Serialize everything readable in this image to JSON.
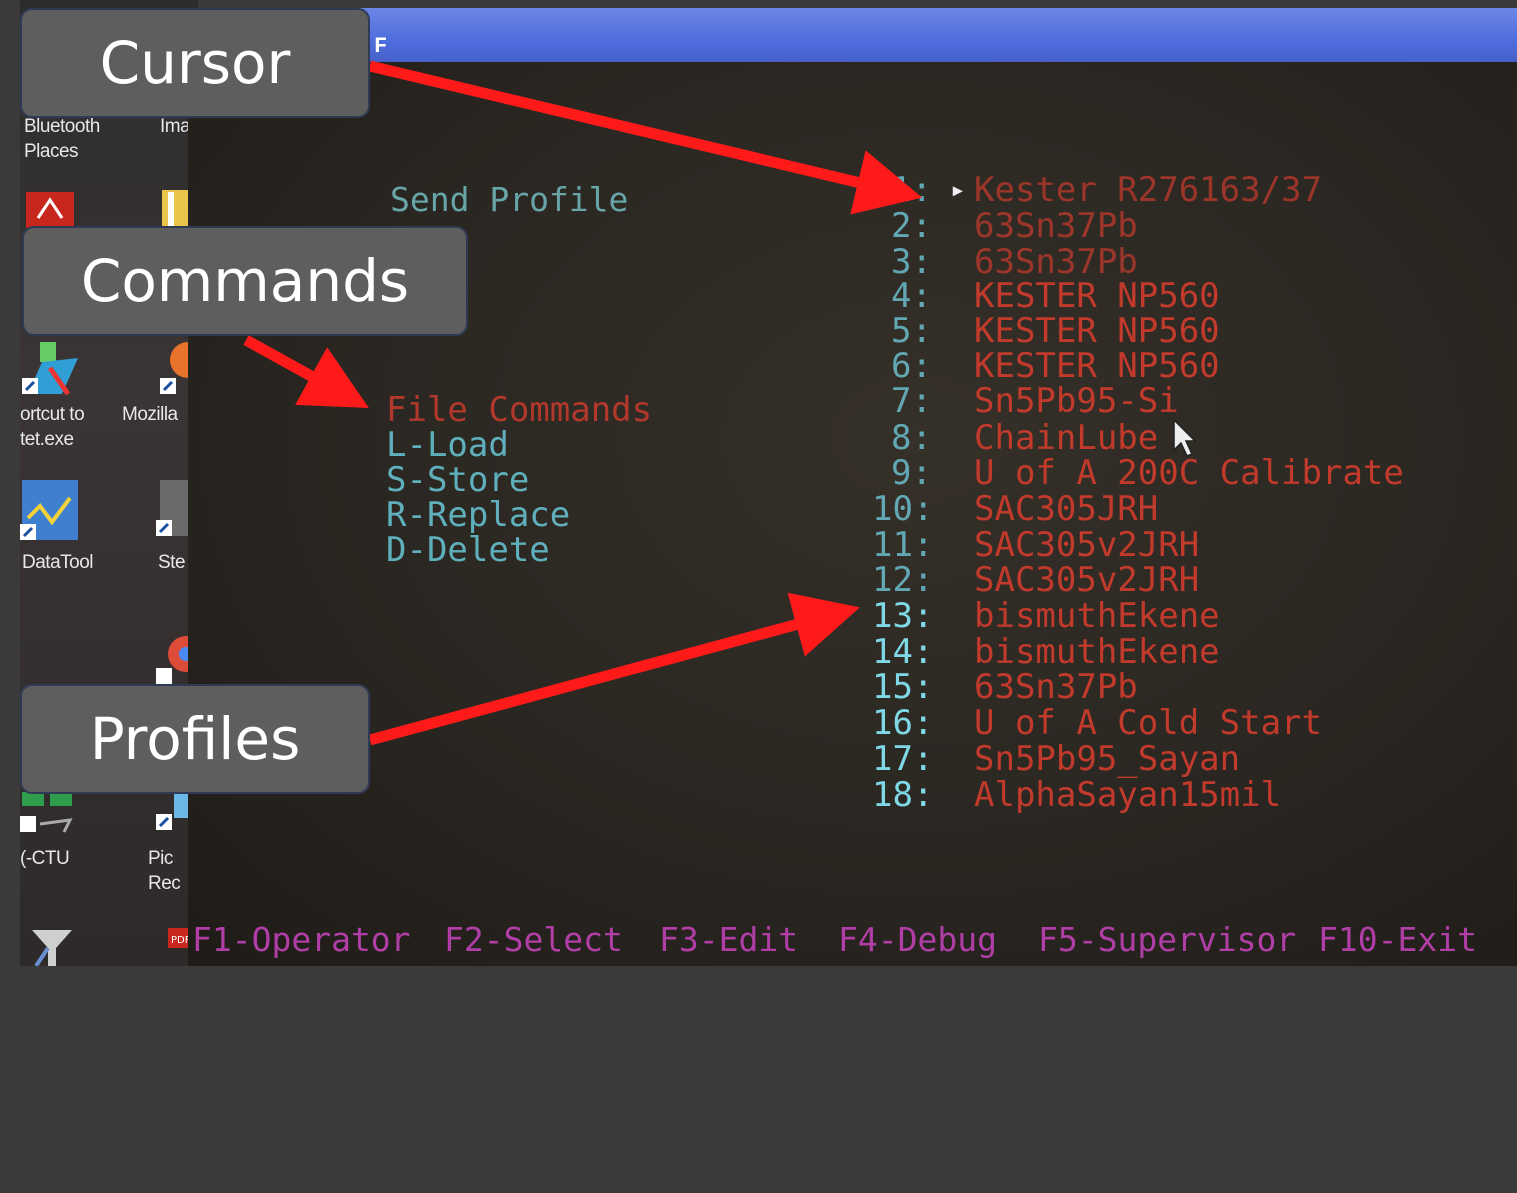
{
  "desktop": {
    "icons": [
      {
        "label": "Bluetooth\nPlaces",
        "icon": "bluetooth-places-icon"
      },
      {
        "label": "Ima",
        "icon": "image-icon"
      },
      {
        "label": "ortcut to\ntet.exe",
        "icon": "shortcut-tet-icon"
      },
      {
        "label": "Mozilla",
        "icon": "mozilla-icon"
      },
      {
        "label": "DataTool",
        "icon": "datatool-icon"
      },
      {
        "label": "Ste",
        "icon": "ste-icon"
      },
      {
        "label": "(-CTU",
        "icon": "xctu-icon"
      },
      {
        "label": "Pic\nRec",
        "icon": "picture-recorder-icon"
      }
    ]
  },
  "window": {
    "title_char": "F"
  },
  "send_profile": "Send Profile",
  "file_commands": {
    "heading": "File Commands",
    "items": [
      "L-Load",
      "S-Store",
      "R-Replace",
      "D-Delete"
    ]
  },
  "profiles": [
    {
      "num": "1:",
      "name": "Kester R276163/37"
    },
    {
      "num": "2:",
      "name": "63Sn37Pb"
    },
    {
      "num": "3:",
      "name": "63Sn37Pb"
    },
    {
      "num": "4:",
      "name": "KESTER NP560"
    },
    {
      "num": "5:",
      "name": "KESTER NP560"
    },
    {
      "num": "6:",
      "name": "KESTER NP560"
    },
    {
      "num": "7:",
      "name": "Sn5Pb95-Si"
    },
    {
      "num": "8:",
      "name": "ChainLube"
    },
    {
      "num": "9:",
      "name": "U of A 200C Calibrate"
    },
    {
      "num": "10:",
      "name": "SAC305JRH"
    },
    {
      "num": "11:",
      "name": "SAC305v2JRH"
    },
    {
      "num": "12:",
      "name": "SAC305v2JRH"
    },
    {
      "num": "13:",
      "name": "bismuthEkene"
    },
    {
      "num": "14:",
      "name": "bismuthEkene"
    },
    {
      "num": "15:",
      "name": "63Sn37Pb"
    },
    {
      "num": "16:",
      "name": "U of A Cold Start"
    },
    {
      "num": "17:",
      "name": "Sn5Pb95_Sayan"
    },
    {
      "num": "18:",
      "name": "AlphaSayan15mil"
    }
  ],
  "selected_marker": "▸",
  "function_keys": [
    "F1-Operator",
    "F2-Select",
    "F3-Edit",
    "F4-Debug",
    "F5-Supervisor",
    "F10-Exit"
  ],
  "callouts": {
    "cursor": "Cursor",
    "commands": "Commands",
    "profiles": "Profiles"
  },
  "colors": {
    "arrow": "#ff1a1a",
    "callout_bg": "#5e5e5e",
    "profile_name": "#c23a2c",
    "profile_num": "#62a8b4",
    "command_text": "#5fb0bc",
    "fkey_text": "#b03ea6"
  }
}
